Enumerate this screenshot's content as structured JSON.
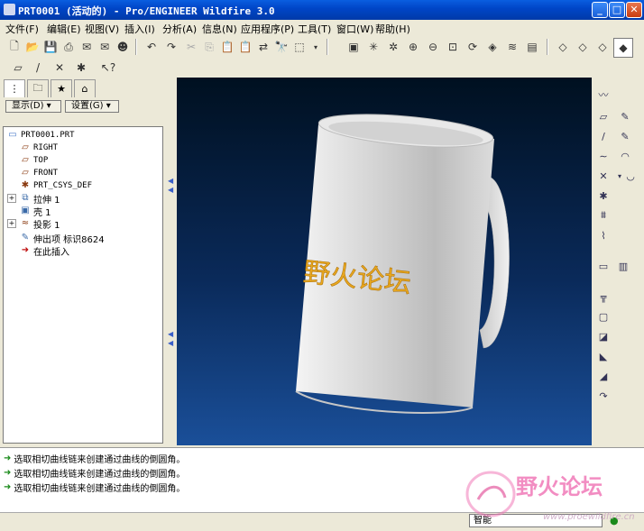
{
  "window": {
    "title": "PRT0001 (活动的) - Pro/ENGINEER Wildfire 3.0"
  },
  "menu": [
    {
      "label": "文件(F)"
    },
    {
      "label": "编辑(E)"
    },
    {
      "label": "视图(V)"
    },
    {
      "label": "插入(I)"
    },
    {
      "label": "分析(A)"
    },
    {
      "label": "信息(N)"
    },
    {
      "label": "应用程序(P)"
    },
    {
      "label": "工具(T)"
    },
    {
      "label": "窗口(W)"
    },
    {
      "label": "帮助(H)"
    }
  ],
  "nav": {
    "show_label": "显示(D) ▾",
    "settings_label": "设置(G) ▾"
  },
  "tree": {
    "items": [
      {
        "label": "PRT0001.PRT",
        "icon": "part-icon"
      },
      {
        "label": "RIGHT",
        "icon": "datum-plane-icon"
      },
      {
        "label": "TOP",
        "icon": "datum-plane-icon"
      },
      {
        "label": "FRONT",
        "icon": "datum-plane-icon"
      },
      {
        "label": "PRT_CSYS_DEF",
        "icon": "csys-icon"
      },
      {
        "label": "拉伸 1",
        "icon": "extrude-icon"
      },
      {
        "label": "壳 1",
        "icon": "shell-icon"
      },
      {
        "label": "投影 1",
        "icon": "project-icon"
      },
      {
        "label": "伸出项 标识8624",
        "icon": "protrusion-icon"
      },
      {
        "label": "在此插入",
        "icon": "insert-here-icon"
      }
    ]
  },
  "model": {
    "text": "野火论坛"
  },
  "messages": [
    {
      "text": "选取相切曲线链来创建通过曲线的倒圆角。"
    },
    {
      "text": "选取相切曲线链来创建通过曲线的倒圆角。"
    },
    {
      "text": "选取相切曲线链来创建通过曲线的倒圆角。"
    }
  ],
  "status": {
    "filter_value": "智能"
  },
  "watermark": {
    "brand": "野火论坛",
    "url": "www.proewildfire.cn"
  },
  "colors": {
    "title_bar": "#0046c8",
    "viewport_top": "#001020",
    "viewport_bottom": "#1a4f99",
    "model_text": "#e8a820",
    "watermark": "#f07ab8"
  }
}
